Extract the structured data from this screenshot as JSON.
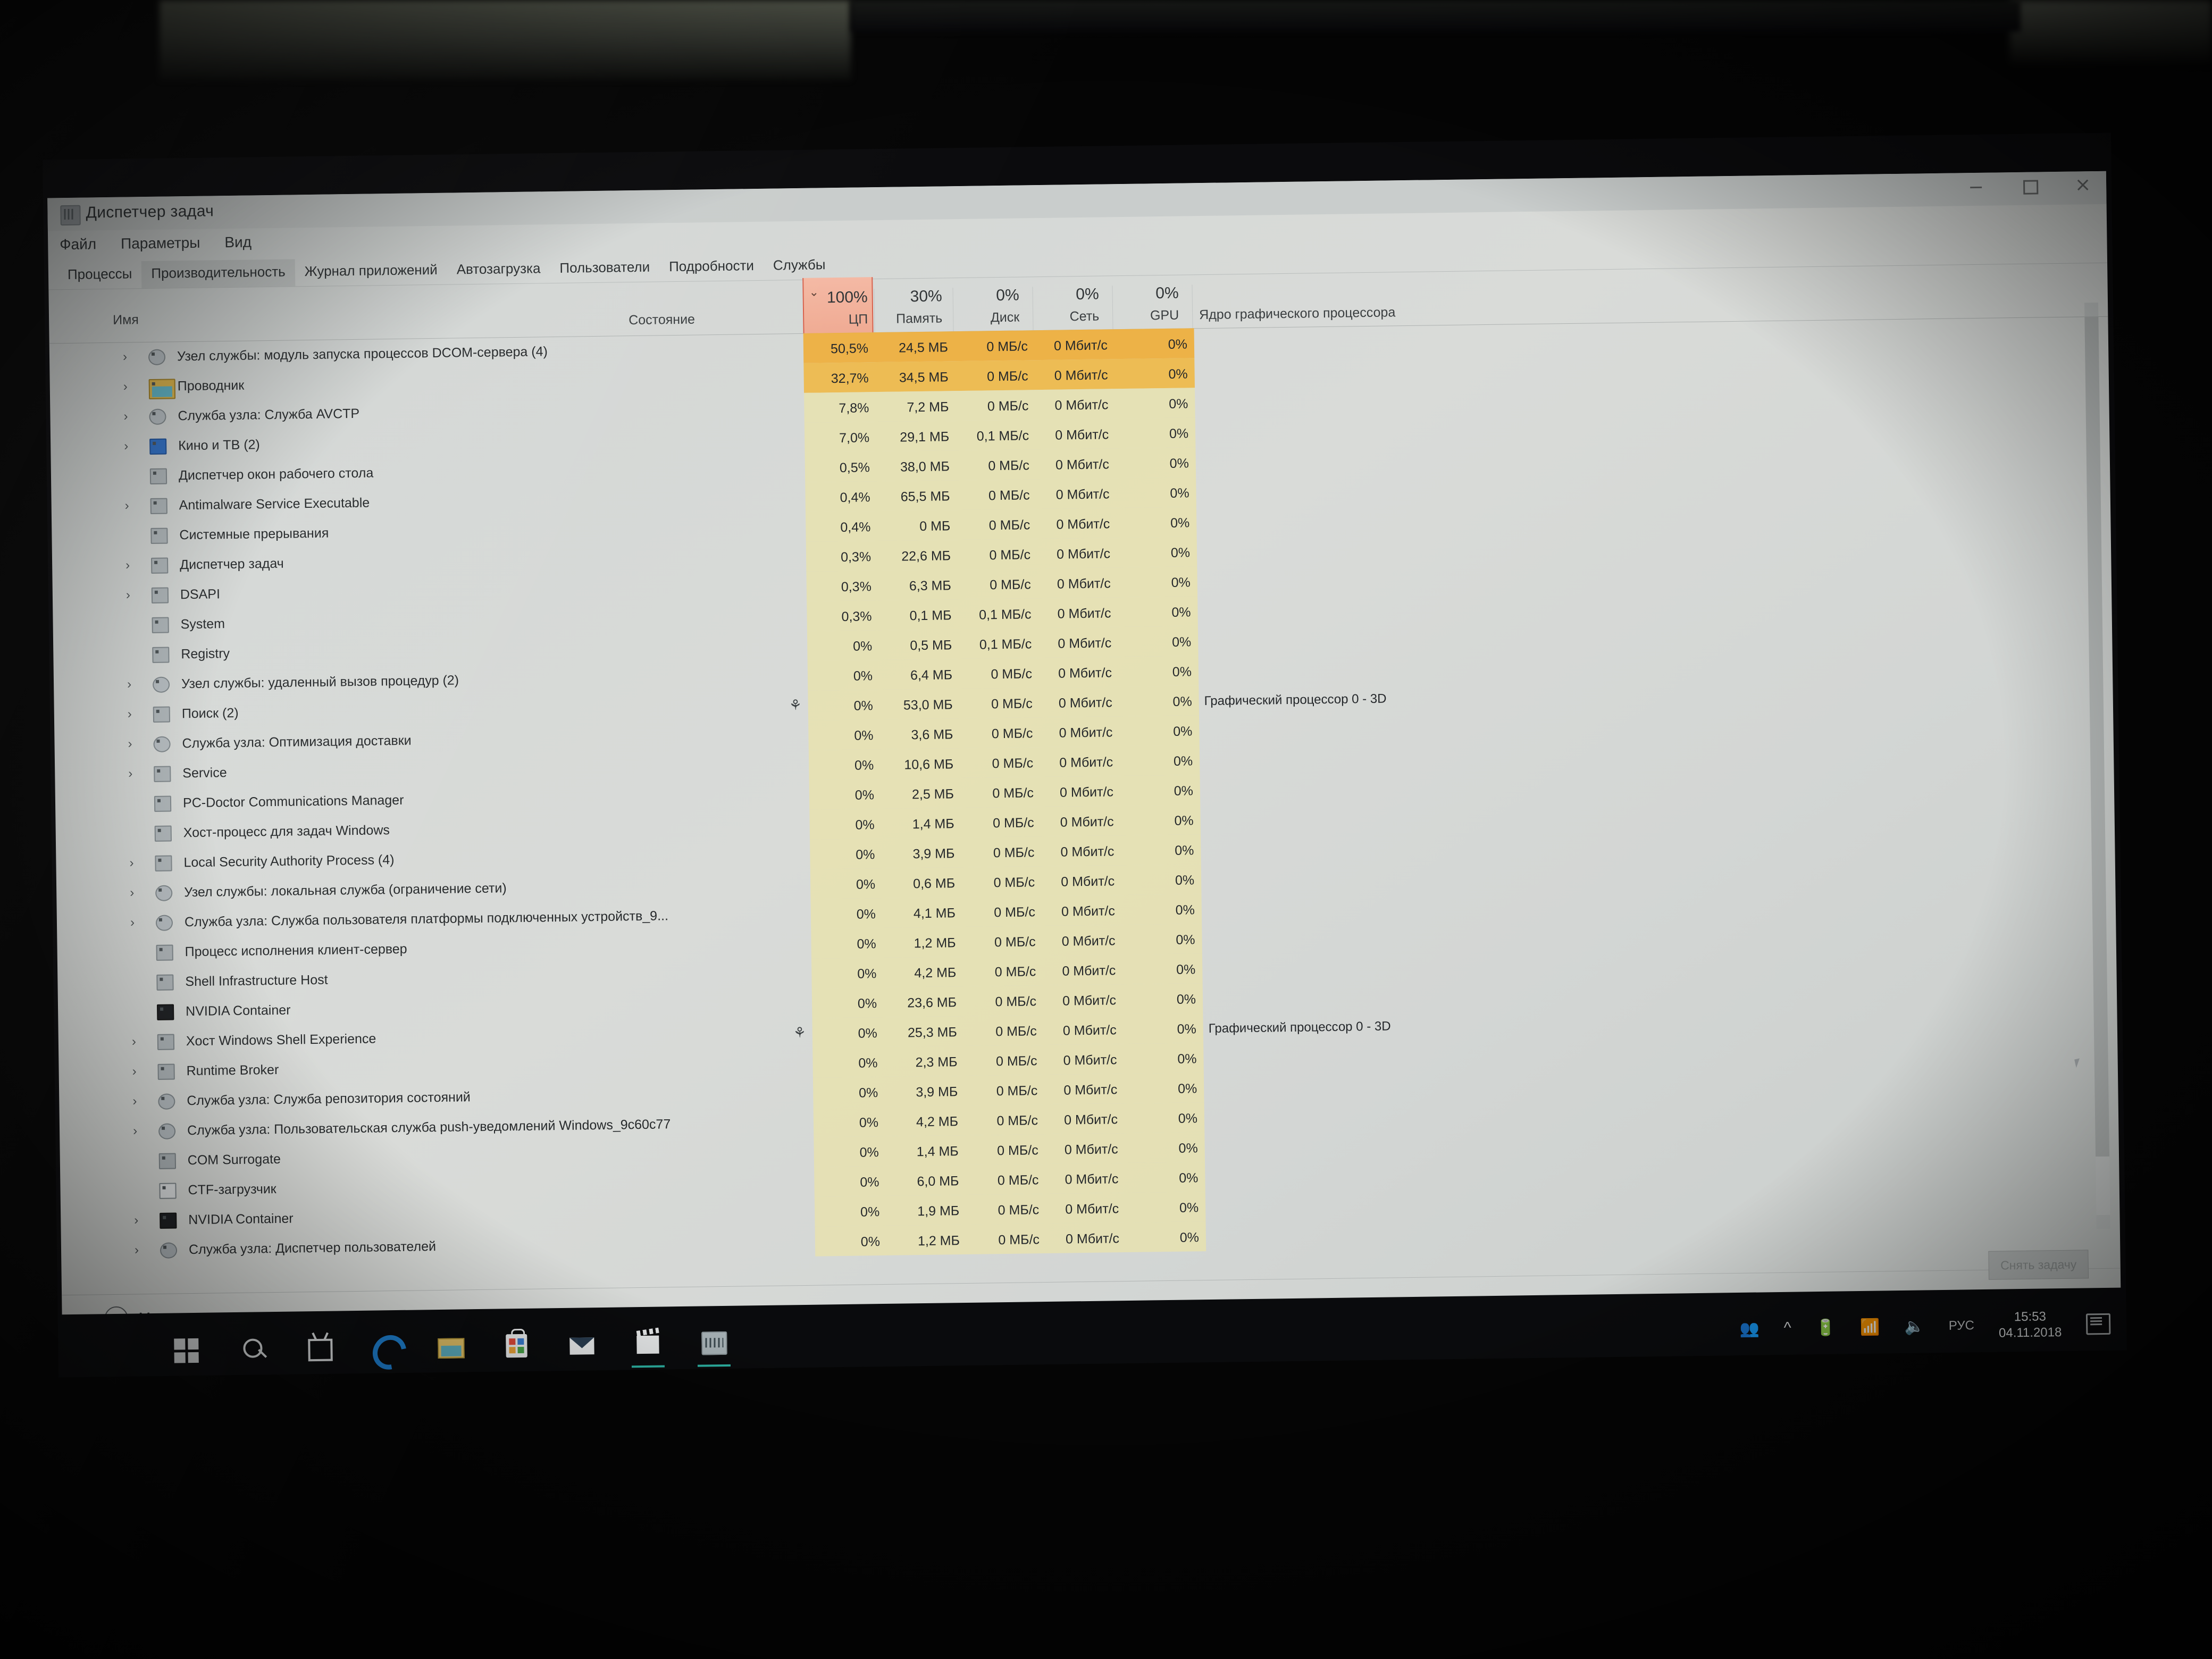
{
  "window": {
    "title": "Диспетчер задач",
    "controls": {
      "minimize": "—",
      "maximize": "□",
      "close": "✕"
    }
  },
  "menu": [
    "Файл",
    "Параметры",
    "Вид"
  ],
  "tabs": [
    {
      "label": "Процессы",
      "selected": false
    },
    {
      "label": "Производительность",
      "selected": true
    },
    {
      "label": "Журнал приложений",
      "selected": false
    },
    {
      "label": "Автозагрузка",
      "selected": false
    },
    {
      "label": "Пользователи",
      "selected": false
    },
    {
      "label": "Подробности",
      "selected": false
    },
    {
      "label": "Службы",
      "selected": false
    }
  ],
  "columns": {
    "name": "Имя",
    "status": "Состояние",
    "cpu": {
      "pct": "100%",
      "label": "ЦП",
      "sorted": true,
      "sort_arrow": "⌄",
      "accent": "#d9604a"
    },
    "memory": {
      "pct": "30%",
      "label": "Память"
    },
    "disk": {
      "pct": "0%",
      "label": "Диск"
    },
    "network": {
      "pct": "0%",
      "label": "Сеть"
    },
    "gpu": {
      "pct": "0%",
      "label": "GPU"
    },
    "gpu_engine": {
      "label": "Ядро графического процессора"
    }
  },
  "rows": [
    {
      "name": "Узел службы: модуль запуска процессов DCOM-сервера (4)",
      "expand": true,
      "icon": "gear",
      "status": "",
      "cpu": "50,5%",
      "mem": "24,5 МБ",
      "disk": "0 МБ/с",
      "net": "0 Мбит/с",
      "gpu": "0%",
      "engine": "",
      "hl": "hot"
    },
    {
      "name": "Проводник",
      "expand": true,
      "icon": "folder",
      "status": "",
      "cpu": "32,7%",
      "mem": "34,5 МБ",
      "disk": "0 МБ/с",
      "net": "0 Мбит/с",
      "gpu": "0%",
      "engine": "",
      "hl": "hot"
    },
    {
      "name": "Служба узла: Служба AVCTP",
      "expand": true,
      "icon": "gear",
      "status": "",
      "cpu": "7,8%",
      "mem": "7,2 МБ",
      "disk": "0 МБ/с",
      "net": "0 Мбит/с",
      "gpu": "0%",
      "engine": "",
      "hl": "warm"
    },
    {
      "name": "Кино и ТВ (2)",
      "expand": true,
      "icon": "blue",
      "status": "",
      "cpu": "7,0%",
      "mem": "29,1 МБ",
      "disk": "0,1 МБ/с",
      "net": "0 Мбит/с",
      "gpu": "0%",
      "engine": "",
      "hl": "warm"
    },
    {
      "name": "Диспетчер окон рабочего стола",
      "expand": false,
      "icon": "app",
      "status": "",
      "cpu": "0,5%",
      "mem": "38,0 МБ",
      "disk": "0 МБ/с",
      "net": "0 Мбит/с",
      "gpu": "0%",
      "engine": "",
      "hl": "warm"
    },
    {
      "name": "Antimalware Service Executable",
      "expand": true,
      "icon": "app",
      "status": "",
      "cpu": "0,4%",
      "mem": "65,5 МБ",
      "disk": "0 МБ/с",
      "net": "0 Мбит/с",
      "gpu": "0%",
      "engine": "",
      "hl": "warm"
    },
    {
      "name": "Системные прерывания",
      "expand": false,
      "icon": "app",
      "status": "",
      "cpu": "0,4%",
      "mem": "0 МБ",
      "disk": "0 МБ/с",
      "net": "0 Мбит/с",
      "gpu": "0%",
      "engine": "",
      "hl": "warm"
    },
    {
      "name": "Диспетчер задач",
      "expand": true,
      "icon": "tm",
      "status": "",
      "cpu": "0,3%",
      "mem": "22,6 МБ",
      "disk": "0 МБ/с",
      "net": "0 Мбит/с",
      "gpu": "0%",
      "engine": "",
      "hl": "warm"
    },
    {
      "name": "DSAPI",
      "expand": true,
      "icon": "app",
      "status": "",
      "cpu": "0,3%",
      "mem": "6,3 МБ",
      "disk": "0 МБ/с",
      "net": "0 Мбит/с",
      "gpu": "0%",
      "engine": "",
      "hl": "warm"
    },
    {
      "name": "System",
      "expand": false,
      "icon": "app",
      "status": "",
      "cpu": "0,3%",
      "mem": "0,1 МБ",
      "disk": "0,1 МБ/с",
      "net": "0 Мбит/с",
      "gpu": "0%",
      "engine": "",
      "hl": "warm"
    },
    {
      "name": "Registry",
      "expand": false,
      "icon": "app",
      "status": "",
      "cpu": "0%",
      "mem": "0,5 МБ",
      "disk": "0,1 МБ/с",
      "net": "0 Мбит/с",
      "gpu": "0%",
      "engine": "",
      "hl": "warm"
    },
    {
      "name": "Узел службы: удаленный вызов процедур (2)",
      "expand": true,
      "icon": "gear",
      "status": "",
      "cpu": "0%",
      "mem": "6,4 МБ",
      "disk": "0 МБ/с",
      "net": "0 Мбит/с",
      "gpu": "0%",
      "engine": "",
      "hl": "warm"
    },
    {
      "name": "Поиск (2)",
      "expand": true,
      "icon": "app",
      "status": "leaf",
      "cpu": "0%",
      "mem": "53,0 МБ",
      "disk": "0 МБ/с",
      "net": "0 Мбит/с",
      "gpu": "0%",
      "engine": "Графический процессор 0 - 3D",
      "hl": "warm"
    },
    {
      "name": "Служба узла: Оптимизация доставки",
      "expand": true,
      "icon": "gear",
      "status": "",
      "cpu": "0%",
      "mem": "3,6 МБ",
      "disk": "0 МБ/с",
      "net": "0 Мбит/с",
      "gpu": "0%",
      "engine": "",
      "hl": "warm"
    },
    {
      "name": "Service",
      "expand": true,
      "icon": "app",
      "status": "",
      "cpu": "0%",
      "mem": "10,6 МБ",
      "disk": "0 МБ/с",
      "net": "0 Мбит/с",
      "gpu": "0%",
      "engine": "",
      "hl": "warm"
    },
    {
      "name": "PC-Doctor Communications Manager",
      "expand": false,
      "icon": "app",
      "status": "",
      "cpu": "0%",
      "mem": "2,5 МБ",
      "disk": "0 МБ/с",
      "net": "0 Мбит/с",
      "gpu": "0%",
      "engine": "",
      "hl": "warm"
    },
    {
      "name": "Хост-процесс для задач Windows",
      "expand": false,
      "icon": "app",
      "status": "",
      "cpu": "0%",
      "mem": "1,4 МБ",
      "disk": "0 МБ/с",
      "net": "0 Мбит/с",
      "gpu": "0%",
      "engine": "",
      "hl": "warm"
    },
    {
      "name": "Local Security Authority Process (4)",
      "expand": true,
      "icon": "app",
      "status": "",
      "cpu": "0%",
      "mem": "3,9 МБ",
      "disk": "0 МБ/с",
      "net": "0 Мбит/с",
      "gpu": "0%",
      "engine": "",
      "hl": "warm"
    },
    {
      "name": "Узел службы: локальная служба (ограничение сети)",
      "expand": true,
      "icon": "gear",
      "status": "",
      "cpu": "0%",
      "mem": "0,6 МБ",
      "disk": "0 МБ/с",
      "net": "0 Мбит/с",
      "gpu": "0%",
      "engine": "",
      "hl": "warm"
    },
    {
      "name": "Служба узла: Служба пользователя платформы подключенных устройств_9...",
      "expand": true,
      "icon": "gear",
      "status": "",
      "cpu": "0%",
      "mem": "4,1 МБ",
      "disk": "0 МБ/с",
      "net": "0 Мбит/с",
      "gpu": "0%",
      "engine": "",
      "hl": "warm"
    },
    {
      "name": "Процесс исполнения клиент-сервер",
      "expand": false,
      "icon": "app",
      "status": "",
      "cpu": "0%",
      "mem": "1,2 МБ",
      "disk": "0 МБ/с",
      "net": "0 Мбит/с",
      "gpu": "0%",
      "engine": "",
      "hl": "warm"
    },
    {
      "name": "Shell Infrastructure Host",
      "expand": false,
      "icon": "app",
      "status": "",
      "cpu": "0%",
      "mem": "4,2 МБ",
      "disk": "0 МБ/с",
      "net": "0 Мбит/с",
      "gpu": "0%",
      "engine": "",
      "hl": "warm"
    },
    {
      "name": "NVIDIA Container",
      "expand": false,
      "icon": "dark",
      "status": "",
      "cpu": "0%",
      "mem": "23,6 МБ",
      "disk": "0 МБ/с",
      "net": "0 Мбит/с",
      "gpu": "0%",
      "engine": "",
      "hl": "warm"
    },
    {
      "name": "Xocт Windows Shell Experience",
      "expand": true,
      "icon": "app",
      "status": "leaf",
      "cpu": "0%",
      "mem": "25,3 МБ",
      "disk": "0 МБ/с",
      "net": "0 Мбит/с",
      "gpu": "0%",
      "engine": "Графический процессор 0 - 3D",
      "hl": "warm"
    },
    {
      "name": "Runtime Broker",
      "expand": true,
      "icon": "app",
      "status": "",
      "cpu": "0%",
      "mem": "2,3 МБ",
      "disk": "0 МБ/с",
      "net": "0 Мбит/с",
      "gpu": "0%",
      "engine": "",
      "hl": "warm"
    },
    {
      "name": "Служба узла: Служба репозитория состояний",
      "expand": true,
      "icon": "gear",
      "status": "",
      "cpu": "0%",
      "mem": "3,9 МБ",
      "disk": "0 МБ/с",
      "net": "0 Мбит/с",
      "gpu": "0%",
      "engine": "",
      "hl": "warm"
    },
    {
      "name": "Служба узла: Пользовательская служба push-уведомлений Windows_9c60c77",
      "expand": true,
      "icon": "gear",
      "status": "",
      "cpu": "0%",
      "mem": "4,2 МБ",
      "disk": "0 МБ/с",
      "net": "0 Мбит/с",
      "gpu": "0%",
      "engine": "",
      "hl": "warm"
    },
    {
      "name": "COM Surrogate",
      "expand": false,
      "icon": "app",
      "status": "",
      "cpu": "0%",
      "mem": "1,4 МБ",
      "disk": "0 МБ/с",
      "net": "0 Мбит/с",
      "gpu": "0%",
      "engine": "",
      "hl": "warm"
    },
    {
      "name": "CTF-загрузчик",
      "expand": false,
      "icon": "doc",
      "status": "",
      "cpu": "0%",
      "mem": "6,0 МБ",
      "disk": "0 МБ/с",
      "net": "0 Мбит/с",
      "gpu": "0%",
      "engine": "",
      "hl": "warm"
    },
    {
      "name": "NVIDIA Container",
      "expand": true,
      "icon": "dark",
      "status": "",
      "cpu": "0%",
      "mem": "1,9 МБ",
      "disk": "0 МБ/с",
      "net": "0 Мбит/с",
      "gpu": "0%",
      "engine": "",
      "hl": "warm"
    },
    {
      "name": "Служба узла: Диспетчер пользователей",
      "expand": true,
      "icon": "gear",
      "status": "",
      "cpu": "0%",
      "mem": "1,2 МБ",
      "disk": "0 МБ/с",
      "net": "0 Мбит/с",
      "gpu": "0%",
      "engine": "",
      "hl": "warm"
    }
  ],
  "footer": {
    "less_label": "Меньше",
    "end_task_label": "Снять задачу"
  },
  "taskbar": {
    "icons": [
      "start-icon",
      "search-icon",
      "task-view-icon",
      "edge-icon",
      "file-explorer-icon",
      "store-icon",
      "mail-icon",
      "movies-tv-icon",
      "task-manager-icon"
    ],
    "tray": {
      "people": "people-icon",
      "chevron": "^",
      "lang": "РУС",
      "time": "15:53",
      "date": "04.11.2018"
    }
  }
}
